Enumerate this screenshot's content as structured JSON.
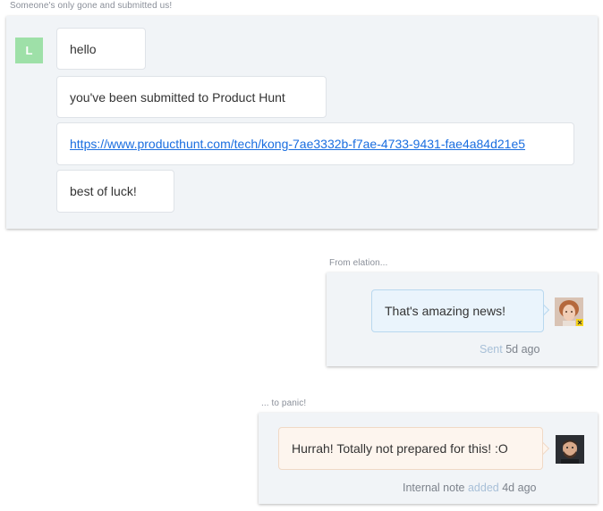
{
  "first_block": {
    "caption": "Someone's only gone and submitted us!",
    "avatar_letter": "L",
    "messages": [
      "hello",
      "you've been submitted to Product Hunt",
      "https://www.producthunt.com/tech/kong-7ae3332b-f7ae-4733-9431-fae4a84d21e5",
      "best of luck!"
    ]
  },
  "second_block": {
    "caption": "From elation...",
    "message": "That's amazing news!",
    "status_word": "Sent",
    "status_time": "5d ago",
    "avatar_icon": "user-photo-woman"
  },
  "third_block": {
    "caption": "... to panic!",
    "message": "Hurrah! Totally not prepared for this! :O",
    "note_label": "Internal note",
    "note_verb": "added",
    "note_time": "4d ago",
    "avatar_icon": "user-photo-man"
  },
  "colors": {
    "panel_bg": "#f1f4f7",
    "letter_avatar": "#9ee0a8",
    "user_bubble": "#eaf4fc",
    "note_bubble": "#fdf5ee",
    "link": "#1a6ee0"
  }
}
